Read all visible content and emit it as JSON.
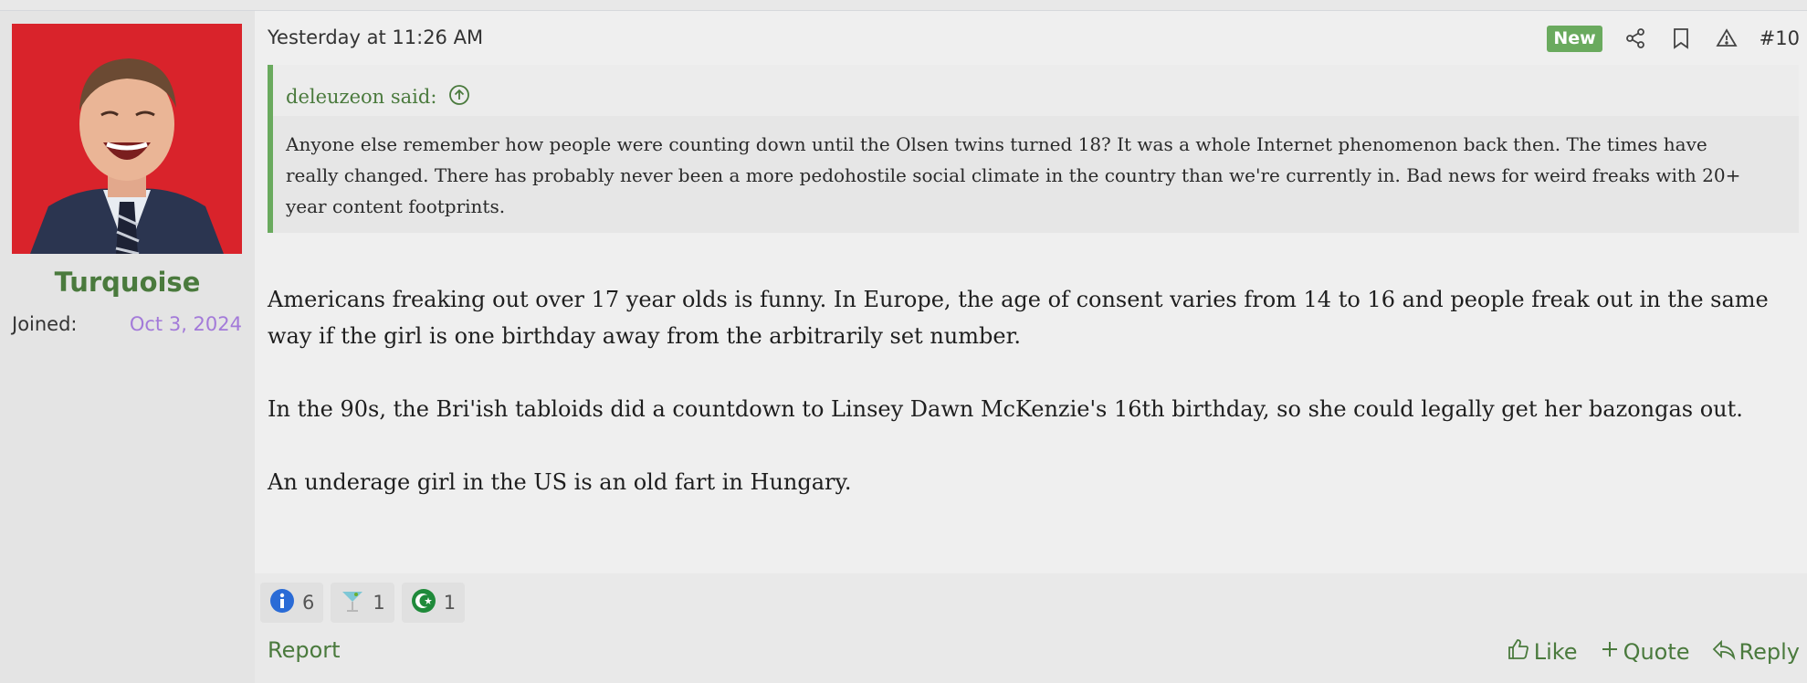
{
  "user": {
    "name": "Turquoise",
    "joined_label": "Joined:",
    "joined_date": "Oct 3, 2024"
  },
  "post": {
    "timestamp": "Yesterday at 11:26 AM",
    "badge": "New",
    "number": "#10",
    "quote": {
      "author": "deleuzeon said:",
      "text": "Anyone else remember how people were counting down until the Olsen twins turned 18? It was a whole Internet phenomenon back then. The times have really changed. There has probably never been a more pedohostile social climate in the country than we're currently in. Bad news for weird freaks with 20+ year content footprints."
    },
    "paragraphs": [
      "Americans freaking out over 17 year olds is funny. In Europe, the age of consent varies from 14 to 16 and people freak out in the same way if the girl is one birthday away from the arbitrarily set number.",
      "In the 90s, the Bri'ish tabloids did a countdown to Linsey Dawn McKenzie's 16th birthday, so she could legally get her bazongas out.",
      "An underage girl in the US is an old fart in Hungary."
    ]
  },
  "reactions": [
    {
      "icon": "info-icon",
      "count": "6"
    },
    {
      "icon": "cocktail-icon",
      "count": "1"
    },
    {
      "icon": "star-crescent-icon",
      "count": "1"
    }
  ],
  "footer": {
    "report": "Report",
    "like": "Like",
    "quote": "Quote",
    "reply": "Reply"
  },
  "colors": {
    "accent": "#4a7a3d",
    "badge_bg": "#6aaa5e",
    "joined_date": "#a37ad9"
  }
}
